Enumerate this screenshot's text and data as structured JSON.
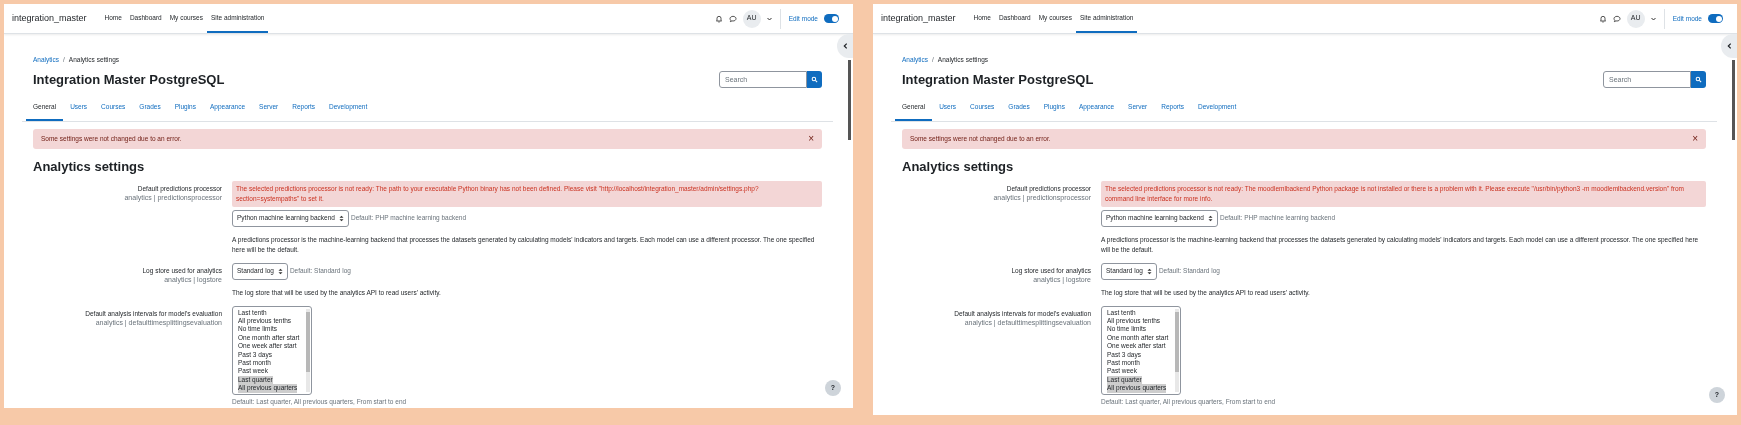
{
  "panels": [
    {
      "site_name": "integration_master",
      "nav": [
        {
          "label": "Home",
          "selected": false
        },
        {
          "label": "Dashboard",
          "selected": false
        },
        {
          "label": "My courses",
          "selected": false
        },
        {
          "label": "Site administration",
          "selected": true
        }
      ],
      "user_initials": "AU",
      "edit_mode": {
        "label": "Edit mode",
        "on": true
      },
      "breadcrumb": [
        {
          "label": "Analytics",
          "kind": "link"
        },
        {
          "label": "Analytics settings",
          "kind": "current"
        }
      ],
      "breadcrumb_separator": "/",
      "title": "Integration Master PostgreSQL",
      "search": {
        "placeholder": "Search"
      },
      "tabs": [
        {
          "label": "General",
          "selected": true
        },
        {
          "label": "Users",
          "selected": false
        },
        {
          "label": "Courses",
          "selected": false
        },
        {
          "label": "Grades",
          "selected": false
        },
        {
          "label": "Plugins",
          "selected": false
        },
        {
          "label": "Appearance",
          "selected": false
        },
        {
          "label": "Server",
          "selected": false
        },
        {
          "label": "Reports",
          "selected": false
        },
        {
          "label": "Development",
          "selected": false
        }
      ],
      "alert": {
        "message": "Some settings were not changed due to an error.",
        "close": "×"
      },
      "heading": "Analytics settings",
      "settings": [
        {
          "kind": "select",
          "label": "Default predictions processor",
          "key": "analytics | predictionsprocessor",
          "error": "The selected predictions processor is not ready: The path to your executable Python binary has not been defined. Please visit \"http://localhost/integration_master/admin/settings.php?section=systempaths\" to set it.",
          "value": "Python machine learning backend",
          "default": "Default: PHP machine learning backend",
          "description": "A predictions processor is the machine-learning backend that processes the datasets generated by calculating models' indicators and targets. Each model can use a different processor. The one specified here will be the default."
        },
        {
          "kind": "select",
          "label": "Log store used for analytics",
          "key": "analytics | logstore",
          "value": "Standard log",
          "default": "Default: Standard log",
          "description": "The log store that will be used by the analytics API to read users' activity."
        },
        {
          "kind": "listbox",
          "label": "Default analysis intervals for model's evaluation",
          "key": "analytics | defaulttimesplittingsevaluation",
          "options": [
            {
              "label": "Last tenth",
              "selected": false
            },
            {
              "label": "All previous tenths",
              "selected": false
            },
            {
              "label": "No time limits",
              "selected": false
            },
            {
              "label": "One month after start",
              "selected": false
            },
            {
              "label": "One week after start",
              "selected": false
            },
            {
              "label": "Past 3 days",
              "selected": false
            },
            {
              "label": "Past month",
              "selected": false
            },
            {
              "label": "Past week",
              "selected": false
            },
            {
              "label": "Last quarter",
              "selected": true
            },
            {
              "label": "All previous quarters",
              "selected": true
            }
          ],
          "default": "Default: Last quarter, All previous quarters, From start to end"
        }
      ],
      "help": "?"
    },
    {
      "site_name": "integration_master",
      "nav": [
        {
          "label": "Home",
          "selected": false
        },
        {
          "label": "Dashboard",
          "selected": false
        },
        {
          "label": "My courses",
          "selected": false
        },
        {
          "label": "Site administration",
          "selected": true
        }
      ],
      "user_initials": "AU",
      "edit_mode": {
        "label": "Edit mode",
        "on": true
      },
      "breadcrumb": [
        {
          "label": "Analytics",
          "kind": "link"
        },
        {
          "label": "Analytics settings",
          "kind": "current"
        }
      ],
      "breadcrumb_separator": "/",
      "title": "Integration Master PostgreSQL",
      "search": {
        "placeholder": "Search"
      },
      "tabs": [
        {
          "label": "General",
          "selected": true
        },
        {
          "label": "Users",
          "selected": false
        },
        {
          "label": "Courses",
          "selected": false
        },
        {
          "label": "Grades",
          "selected": false
        },
        {
          "label": "Plugins",
          "selected": false
        },
        {
          "label": "Appearance",
          "selected": false
        },
        {
          "label": "Server",
          "selected": false
        },
        {
          "label": "Reports",
          "selected": false
        },
        {
          "label": "Development",
          "selected": false
        }
      ],
      "alert": {
        "message": "Some settings were not changed due to an error.",
        "close": "×"
      },
      "heading": "Analytics settings",
      "settings": [
        {
          "kind": "select",
          "label": "Default predictions processor",
          "key": "analytics | predictionsprocessor",
          "error": "The selected predictions processor is not ready: The moodlemlbackend Python package is not installed or there is a problem with it. Please execute \"/usr/bin/python3 -m moodlemlbackend.version\" from command line interface for more info.",
          "value": "Python machine learning backend",
          "default": "Default: PHP machine learning backend",
          "description": "A predictions processor is the machine-learning backend that processes the datasets generated by calculating models' indicators and targets. Each model can use a different processor. The one specified here will be the default."
        },
        {
          "kind": "select",
          "label": "Log store used for analytics",
          "key": "analytics | logstore",
          "value": "Standard log",
          "default": "Default: Standard log",
          "description": "The log store that will be used by the analytics API to read users' activity."
        },
        {
          "kind": "listbox",
          "label": "Default analysis intervals for model's evaluation",
          "key": "analytics | defaulttimesplittingsevaluation",
          "options": [
            {
              "label": "Last tenth",
              "selected": false
            },
            {
              "label": "All previous tenths",
              "selected": false
            },
            {
              "label": "No time limits",
              "selected": false
            },
            {
              "label": "One month after start",
              "selected": false
            },
            {
              "label": "One week after start",
              "selected": false
            },
            {
              "label": "Past 3 days",
              "selected": false
            },
            {
              "label": "Past month",
              "selected": false
            },
            {
              "label": "Past week",
              "selected": false
            },
            {
              "label": "Last quarter",
              "selected": true
            },
            {
              "label": "All previous quarters",
              "selected": true
            }
          ],
          "default": "Default: Last quarter, All previous quarters, From start to end"
        }
      ],
      "help": "?"
    }
  ]
}
